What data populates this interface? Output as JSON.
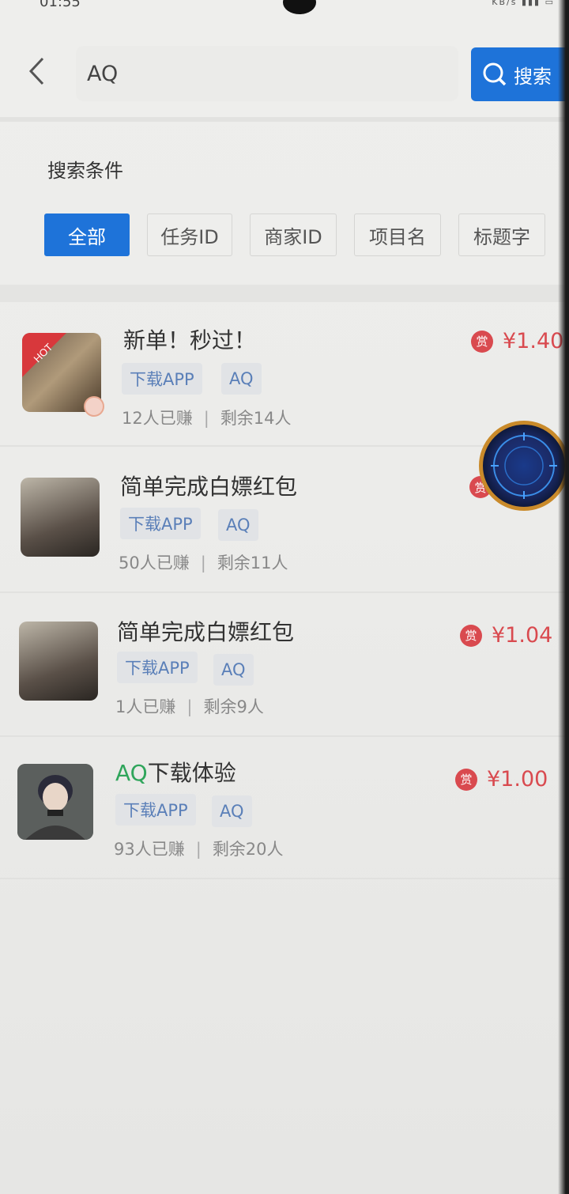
{
  "status_bar": {
    "time": "01:55",
    "icons_text": "KB/s"
  },
  "header": {
    "back_icon": "chevron-left-icon",
    "search": {
      "value": "AQ",
      "placeholder": ""
    },
    "search_button_label": "搜索",
    "search_icon": "search-icon"
  },
  "conditions": {
    "title": "搜索条件",
    "filters": [
      {
        "label": "全部",
        "active": true
      },
      {
        "label": "任务ID",
        "active": false
      },
      {
        "label": "商家ID",
        "active": false
      },
      {
        "label": "项目名",
        "active": false
      },
      {
        "label": "标题字",
        "active": false
      }
    ]
  },
  "tasks": [
    {
      "title": "新单！秒过！",
      "tags": [
        "下载APP",
        "AQ"
      ],
      "earned": "12人已赚",
      "remaining": "剩余14人",
      "reward_badge": "赏",
      "reward": "¥1.40",
      "hot_label": "HOT"
    },
    {
      "title": "简单完成白嫖红包",
      "tags": [
        "下载APP",
        "AQ"
      ],
      "earned": "50人已赚",
      "remaining": "剩余11人",
      "reward_badge": "赏",
      "reward": ""
    },
    {
      "title": "简单完成白嫖红包",
      "tags": [
        "下载APP",
        "AQ"
      ],
      "earned": "1人已赚",
      "remaining": "剩余9人",
      "reward_badge": "赏",
      "reward": "¥1.04"
    },
    {
      "title_highlight": "AQ",
      "title_rest": "下载体验",
      "tags": [
        "下载APP",
        "AQ"
      ],
      "earned": "93人已赚",
      "remaining": "剩余20人",
      "reward_badge": "赏",
      "reward": "¥1.00"
    }
  ],
  "colors": {
    "accent": "#1e73d9",
    "reward": "#d94a4f",
    "tag_text": "#5a7fb8",
    "highlight": "#2fa55b"
  }
}
